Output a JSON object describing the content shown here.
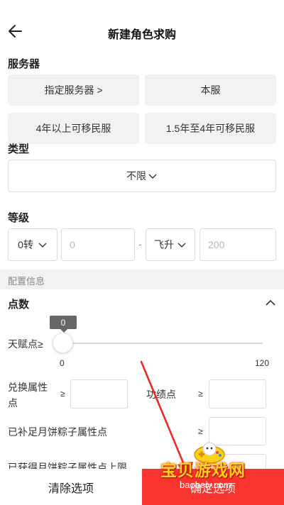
{
  "header": {
    "title": "新建角色求购",
    "back_icon": "arrow-left-icon"
  },
  "server": {
    "label": "服务器",
    "options": [
      "指定服务器 >",
      "本服",
      "4年以上可移民服",
      "1.5年至4年可移民服"
    ]
  },
  "type": {
    "label": "类型",
    "value": "不限",
    "icon": "chevron-down-icon"
  },
  "level": {
    "label": "等级",
    "min_turn": "0转",
    "min_value_placeholder": "0",
    "separator": "-",
    "max_turn": "飞升",
    "max_value_placeholder": "200"
  },
  "config": {
    "label": "配置信息"
  },
  "points": {
    "label": "点数",
    "collapse_icon": "chevron-up-icon",
    "talent": {
      "label": "天赋点≥",
      "value": "0",
      "min": "0",
      "max": "120",
      "fraction": 0
    },
    "exchange": {
      "label_line1": "兑换属性",
      "label_line2": "点",
      "op": "≥"
    },
    "merit": {
      "label": "功绩点",
      "op": "≥"
    },
    "mooncake": {
      "label": "已补足月饼粽子属性点",
      "op": "≥"
    },
    "mooncake_limit": {
      "label": "已获得月饼粽子属性点上限"
    }
  },
  "footer": {
    "clear_label": "清除选项",
    "confirm_label": "确定选项"
  },
  "watermark": {
    "site": "宝贝游戏网",
    "url": "baobeiy.com"
  },
  "colors": {
    "accent": "#f7352e",
    "pill_bg": "#f2f2f2",
    "border": "#dcdcdc"
  }
}
